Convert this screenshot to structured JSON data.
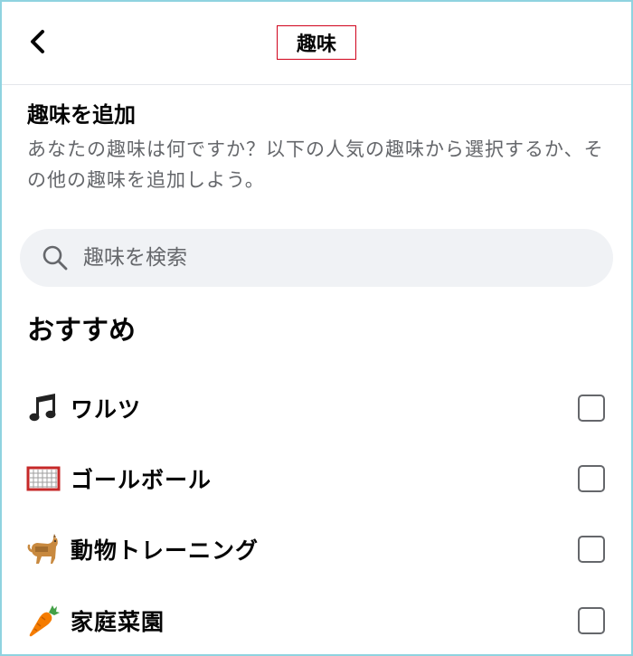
{
  "header": {
    "title": "趣味",
    "back_icon": "chevron-left-icon"
  },
  "section": {
    "title": "趣味を追加",
    "description": "あなたの趣味は何ですか？以下の人気の趣味から選択するか、その他の趣味を追加しよう。"
  },
  "search": {
    "placeholder": "趣味を検索",
    "value": "",
    "icon": "search-icon"
  },
  "recommendations": {
    "title": "おすすめ",
    "items": [
      {
        "label": "ワルツ",
        "icon": "music-note-icon",
        "checked": false
      },
      {
        "label": "ゴールボール",
        "icon": "goal-net-icon",
        "checked": false
      },
      {
        "label": "動物トレーニング",
        "icon": "dog-icon",
        "checked": false
      },
      {
        "label": "家庭菜園",
        "icon": "carrot-icon",
        "checked": false
      }
    ]
  },
  "colors": {
    "frame": "#8fd3e0",
    "title_highlight": "#d0021b",
    "search_bg": "#f0f2f5",
    "secondary_text": "#65676b"
  }
}
